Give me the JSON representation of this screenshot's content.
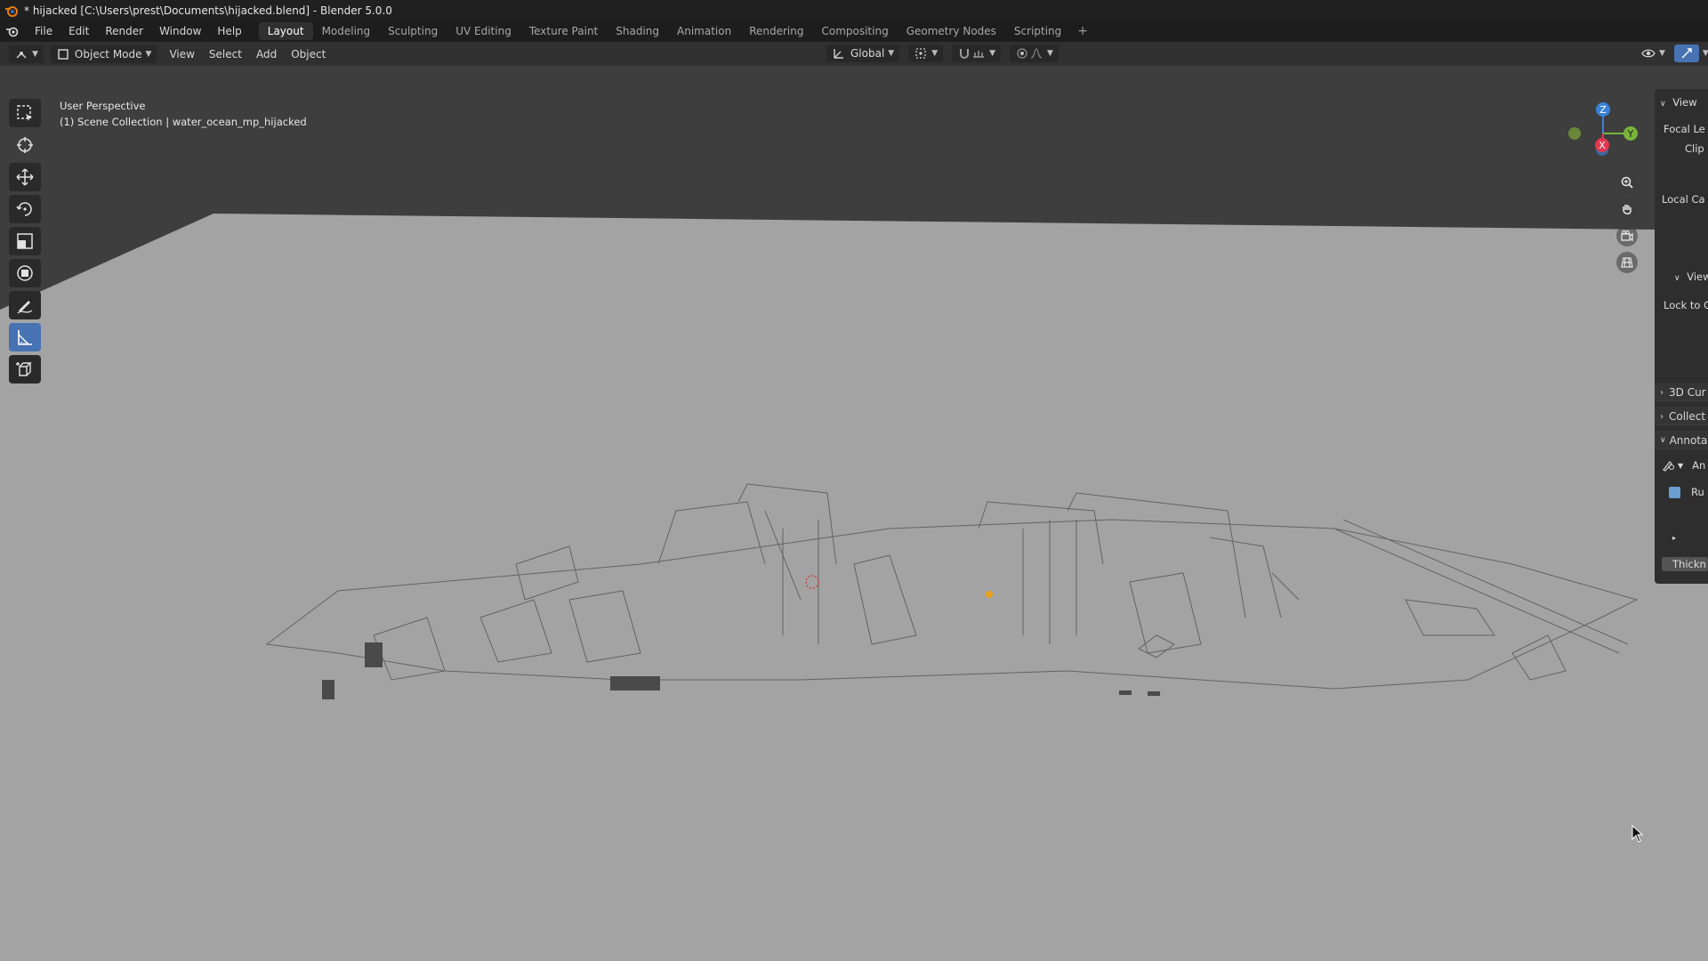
{
  "window": {
    "title": "* hijacked [C:\\Users\\prest\\Documents\\hijacked.blend] - Blender 5.0.0"
  },
  "menu": [
    "File",
    "Edit",
    "Render",
    "Window",
    "Help"
  ],
  "workspaces": {
    "tabs": [
      "Layout",
      "Modeling",
      "Sculpting",
      "UV Editing",
      "Texture Paint",
      "Shading",
      "Animation",
      "Rendering",
      "Compositing",
      "Geometry Nodes",
      "Scripting"
    ],
    "active": "Layout",
    "add_label": "+"
  },
  "header": {
    "mode_label": "Object Mode",
    "view_menu": [
      "View",
      "Select",
      "Add",
      "Object"
    ],
    "transform_orientation": "Global"
  },
  "viewport": {
    "perspective_label": "User Perspective",
    "collection_label": "(1) Scene Collection | water_ocean_mp_hijacked"
  },
  "gizmo": {
    "axes": [
      "Z",
      "Y",
      "X"
    ],
    "colors": {
      "z": "#3b82d6",
      "y": "#77b53a",
      "x": "#e0394f"
    }
  },
  "npanel": {
    "view_header": "View",
    "focal": "Focal Le",
    "clip": "Clip S",
    "local_cam": "Local Ca",
    "view_lock_header": "View",
    "lock_to": "Lock to C",
    "cursor_header": "3D Cur",
    "collections_header": "Collect",
    "annotations_header": "Annota",
    "annotation_name": "An",
    "layer_name": "Ru",
    "thickness": "Thickn"
  },
  "colors": {
    "accent": "#4772b3",
    "background_grey": "#a3a3a3"
  }
}
